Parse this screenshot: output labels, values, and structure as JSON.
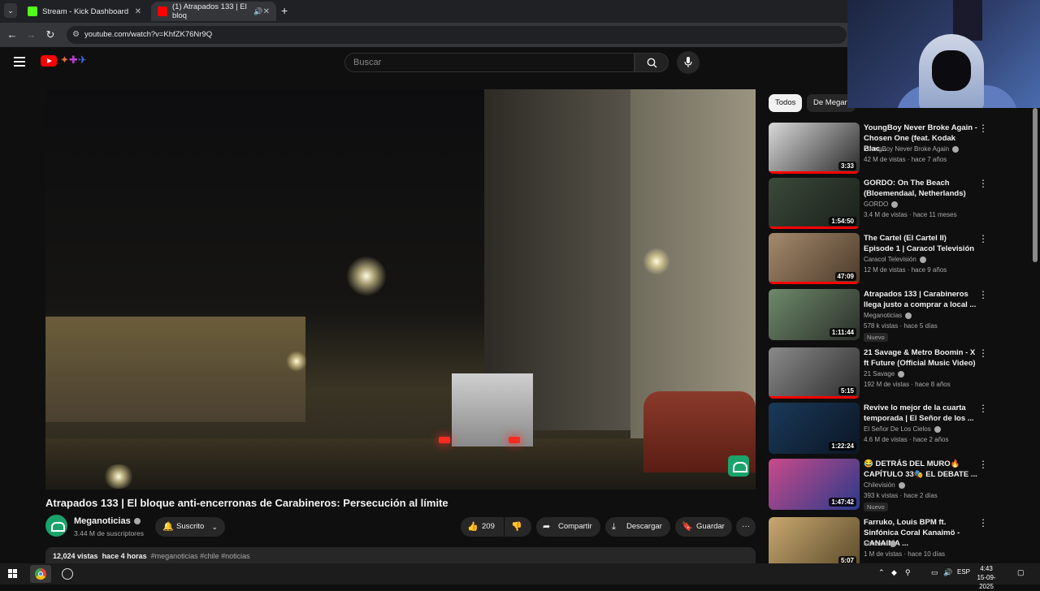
{
  "browser": {
    "tabs": [
      {
        "title": "Stream - Kick Dashboard",
        "active": false,
        "favicon_color": "#53fc18"
      },
      {
        "title": "(1) Atrapados 133 | El bloq",
        "active": true,
        "favicon_color": "#ff0000"
      }
    ],
    "new_tab_symbol": "+",
    "url": "youtube.com/watch?v=KhfZK76Nr9Q"
  },
  "youtube": {
    "search_placeholder": "Buscar",
    "icons": {
      "menu": "menu-icon",
      "search": "search-icon",
      "mic": "mic-icon"
    }
  },
  "video": {
    "title": "Atrapados 133 | El bloque anti-encerronas de Carabineros: Persecución al límite",
    "channel": {
      "name": "Meganoticias",
      "subscribers": "3.44 M de suscriptores",
      "verified": true
    },
    "subscribe_label": "Suscrito",
    "likes": "209",
    "share_label": "Compartir",
    "download_label": "Descargar",
    "save_label": "Guardar",
    "more_symbol": "···",
    "description": {
      "views": "12,024 vistas",
      "age": "hace 4 horas",
      "tags": "#meganoticias #chile #noticias"
    }
  },
  "sidebar": {
    "chips": [
      {
        "label": "Todos",
        "selected": true
      },
      {
        "label": "De Megan",
        "selected": false
      }
    ],
    "recommendations": [
      {
        "title": "YoungBoy Never Broke Again - Chosen One (feat. Kodak Blac...",
        "channel": "YoungBoy Never Broke Again",
        "verified": true,
        "meta": "42 M de vistas · hace 7 años",
        "duration": "3:33",
        "badge": "",
        "thumb_colors": [
          "#d9d9d9",
          "#2a2a2a"
        ],
        "progress": 1.0
      },
      {
        "title": "GORDO: On The Beach (Bloemendaal, Netherlands)",
        "channel": "GORDO",
        "verified": true,
        "meta": "3.4 M de vistas · hace 11 meses",
        "duration": "1:54:50",
        "badge": "",
        "thumb_colors": [
          "#3a4a3a",
          "#1b1f1b"
        ],
        "progress": 1.0
      },
      {
        "title": "The Cartel (El Cartel II) Episode 1 | Caracol Televisión",
        "channel": "Caracol Televisión",
        "verified": true,
        "meta": "12 M de vistas · hace 9 años",
        "duration": "47:09",
        "badge": "",
        "thumb_colors": [
          "#a58a6c",
          "#4b3a2a"
        ],
        "progress": 1.0
      },
      {
        "title": "Atrapados 133 | Carabineros llega justo a comprar a local ...",
        "channel": "Meganoticias",
        "verified": true,
        "meta": "578 k vistas · hace 5 días",
        "duration": "1:11:44",
        "badge": "Nuevo",
        "thumb_colors": [
          "#6e8a6a",
          "#2b2f2a"
        ],
        "progress": 0
      },
      {
        "title": "21 Savage & Metro Boomin - X ft Future (Official Music Video)",
        "channel": "21 Savage",
        "verified": true,
        "meta": "192 M de vistas · hace 8 años",
        "duration": "5:15",
        "badge": "",
        "thumb_colors": [
          "#8a8a8a",
          "#2e2e2e"
        ],
        "progress": 1.0
      },
      {
        "title": "Revive lo mejor de la cuarta temporada | El Señor de los ...",
        "channel": "El Señor De Los Cielos",
        "verified": true,
        "meta": "4.6 M de vistas · hace 2 años",
        "duration": "1:22:24",
        "badge": "",
        "thumb_colors": [
          "#1a3a5a",
          "#0b1524"
        ],
        "progress": 0
      },
      {
        "title": "😂 DETRÁS DEL MURO🔥 CAPÍTULO 33🎭 EL DEBATE ...",
        "channel": "Chilevisión",
        "verified": true,
        "meta": "393 k vistas · hace 2 días",
        "duration": "1:47:42",
        "badge": "Nuevo",
        "thumb_colors": [
          "#c94a8a",
          "#2a3a8a"
        ],
        "progress": 0
      },
      {
        "title": "Farruko, Louis BPM ft. Sinfónica Coral Kanaimö - CANAIMA ...",
        "channel": "Farruko",
        "verified": true,
        "meta": "1 M de vistas · hace 10 días",
        "duration": "5:07",
        "badge": "",
        "thumb_colors": [
          "#c9a870",
          "#5a4a2a"
        ],
        "progress": 0
      }
    ],
    "kebab_symbol": "⋮"
  },
  "taskbar": {
    "apps": [
      {
        "name": "chrome",
        "color": "#4285f4"
      },
      {
        "name": "obs",
        "color": "#3a3a3a"
      }
    ],
    "language": "ESP",
    "time": "4:43",
    "date": "15-09-2025"
  }
}
